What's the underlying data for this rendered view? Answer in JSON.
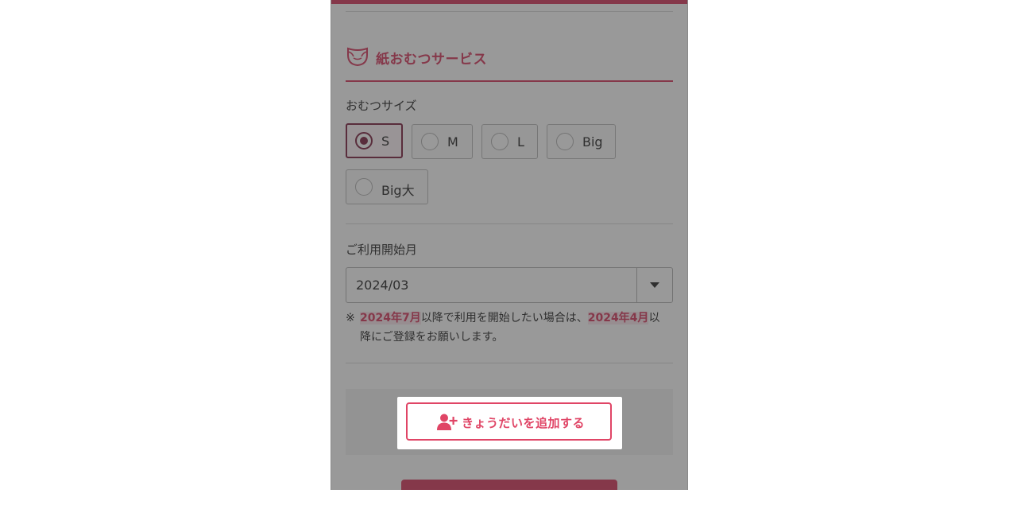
{
  "section": {
    "title": "紙おむつサービス"
  },
  "diaper_size": {
    "label": "おむつサイズ",
    "options": [
      {
        "label": "S",
        "selected": true
      },
      {
        "label": "M",
        "selected": false
      },
      {
        "label": "L",
        "selected": false
      },
      {
        "label": "Big",
        "selected": false
      },
      {
        "label": "Big大",
        "selected": false
      }
    ]
  },
  "start_month": {
    "label": "ご利用開始月",
    "selected_value": "2024/03"
  },
  "note": {
    "mark": "※",
    "highlight1": "2024年7月",
    "text1": "以降で利用を開始したい場合は、",
    "highlight2": "2024年4月",
    "text2": "以",
    "line2": "降にご登録をお願いします。"
  },
  "add_sibling_button": {
    "label": "きょうだいを追加する",
    "icon": "user-plus-icon"
  },
  "colors": {
    "accent": "#d6355a",
    "selected": "#7a1e3e",
    "button_text": "#e04566",
    "overlay": "rgba(60,60,60,0.52)"
  }
}
